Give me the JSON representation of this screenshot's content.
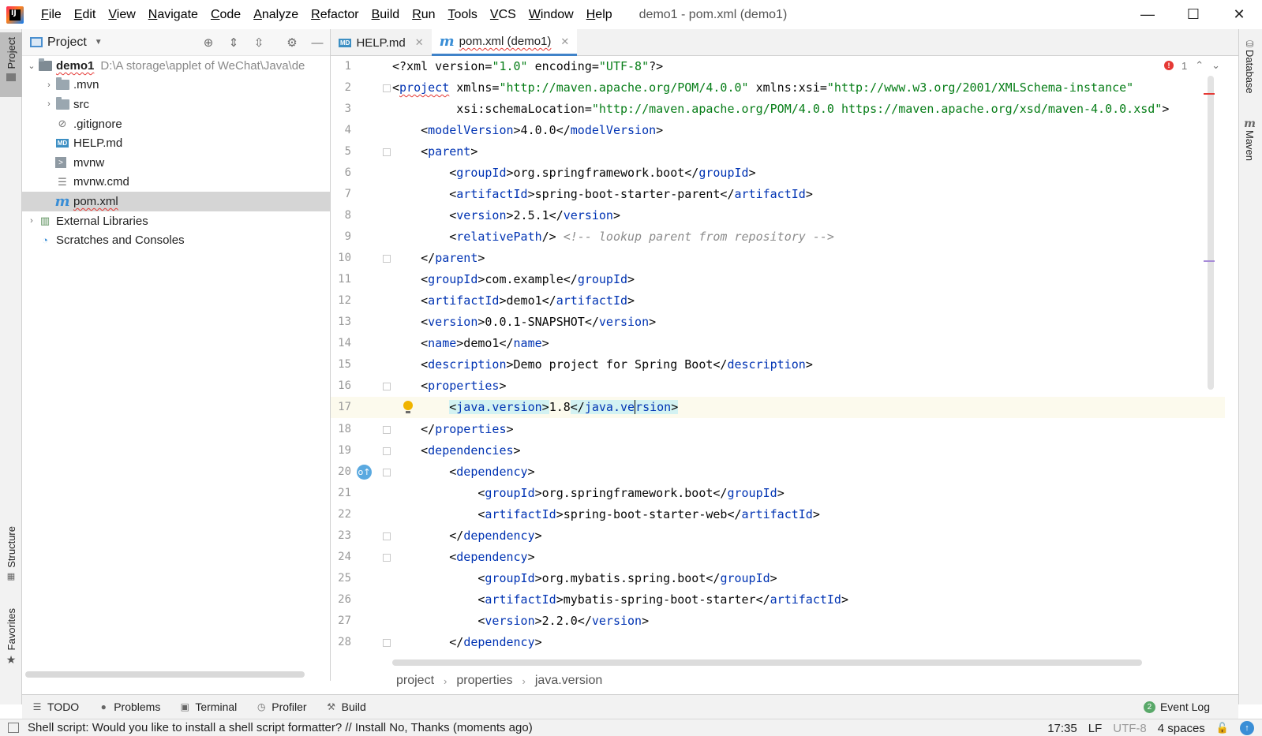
{
  "window": {
    "logo_text": "IJ",
    "menu": [
      "File",
      "Edit",
      "View",
      "Navigate",
      "Code",
      "Analyze",
      "Refactor",
      "Build",
      "Run",
      "Tools",
      "VCS",
      "Window",
      "Help"
    ],
    "title": "demo1 - pom.xml (demo1)",
    "controls": {
      "minimize": "—",
      "maximize": "☐",
      "close": "✕"
    }
  },
  "left_strip": {
    "project_label": "Project",
    "structure_label": "Structure",
    "favorites_label": "Favorites"
  },
  "right_strip": {
    "database_label": "Database",
    "maven_label": "Maven"
  },
  "project_panel": {
    "title": "Project",
    "tree": [
      {
        "label": "demo1",
        "path": "D:\\A storage\\applet of WeChat\\Java\\de",
        "icon": "module-folder-icon",
        "expanded": true,
        "bold": true
      },
      {
        "label": ".mvn",
        "icon": "folder-icon"
      },
      {
        "label": "src",
        "icon": "folder-icon"
      },
      {
        "label": ".gitignore",
        "icon": "ignore-file-icon"
      },
      {
        "label": "HELP.md",
        "icon": "markdown-file-icon"
      },
      {
        "label": "mvnw",
        "icon": "shell-file-icon"
      },
      {
        "label": "mvnw.cmd",
        "icon": "text-file-icon"
      },
      {
        "label": "pom.xml",
        "icon": "maven-file-icon",
        "selected": true
      },
      {
        "label": "External Libraries",
        "icon": "libraries-icon"
      },
      {
        "label": "Scratches and Consoles",
        "icon": "scratches-icon"
      }
    ]
  },
  "editor_tabs": [
    {
      "label": "HELP.md",
      "icon": "MD",
      "active": false
    },
    {
      "label": "pom.xml (demo1)",
      "icon": "m",
      "active": true
    }
  ],
  "editor": {
    "error_count": "1",
    "current_line": 17,
    "lines": [
      "<?xml version=\"1.0\" encoding=\"UTF-8\"?>",
      "<project xmlns=\"http://maven.apache.org/POM/4.0.0\" xmlns:xsi=\"http://www.w3.org/2001/XMLSchema-instance\"",
      "         xsi:schemaLocation=\"http://maven.apache.org/POM/4.0.0 https://maven.apache.org/xsd/maven-4.0.0.xsd\">",
      "    <modelVersion>4.0.0</modelVersion>",
      "    <parent>",
      "        <groupId>org.springframework.boot</groupId>",
      "        <artifactId>spring-boot-starter-parent</artifactId>",
      "        <version>2.5.1</version>",
      "        <relativePath/> <!-- lookup parent from repository -->",
      "    </parent>",
      "    <groupId>com.example</groupId>",
      "    <artifactId>demo1</artifactId>",
      "    <version>0.0.1-SNAPSHOT</version>",
      "    <name>demo1</name>",
      "    <description>Demo project for Spring Boot</description>",
      "    <properties>",
      "        <java.version>1.8</java.version>",
      "    </properties>",
      "    <dependencies>",
      "        <dependency>",
      "            <groupId>org.springframework.boot</groupId>",
      "            <artifactId>spring-boot-starter-web</artifactId>",
      "        </dependency>",
      "        <dependency>",
      "            <groupId>org.mybatis.spring.boot</groupId>",
      "            <artifactId>mybatis-spring-boot-starter</artifactId>",
      "            <version>2.2.0</version>",
      "        </dependency>"
    ]
  },
  "breadcrumb": [
    "project",
    "properties",
    "java.version"
  ],
  "tool_windows": [
    {
      "label": "TODO",
      "icon": "list-icon"
    },
    {
      "label": "Problems",
      "icon": "problems-icon"
    },
    {
      "label": "Terminal",
      "icon": "terminal-icon"
    },
    {
      "label": "Profiler",
      "icon": "profiler-icon"
    },
    {
      "label": "Build",
      "icon": "hammer-icon"
    }
  ],
  "event_log": {
    "label": "Event Log",
    "count": "2"
  },
  "status": {
    "message": "Shell script: Would you like to install a shell script formatter? // Install   No, Thanks (moments ago)",
    "position": "17:35",
    "line_sep": "LF",
    "encoding": "UTF-8",
    "indent": "4 spaces"
  },
  "colors": {
    "tag": "#0033b3",
    "attr": "#174ad4",
    "value": "#067d17",
    "ns": "#871094",
    "comment": "#8c8c8c",
    "accent": "#4083c9"
  }
}
